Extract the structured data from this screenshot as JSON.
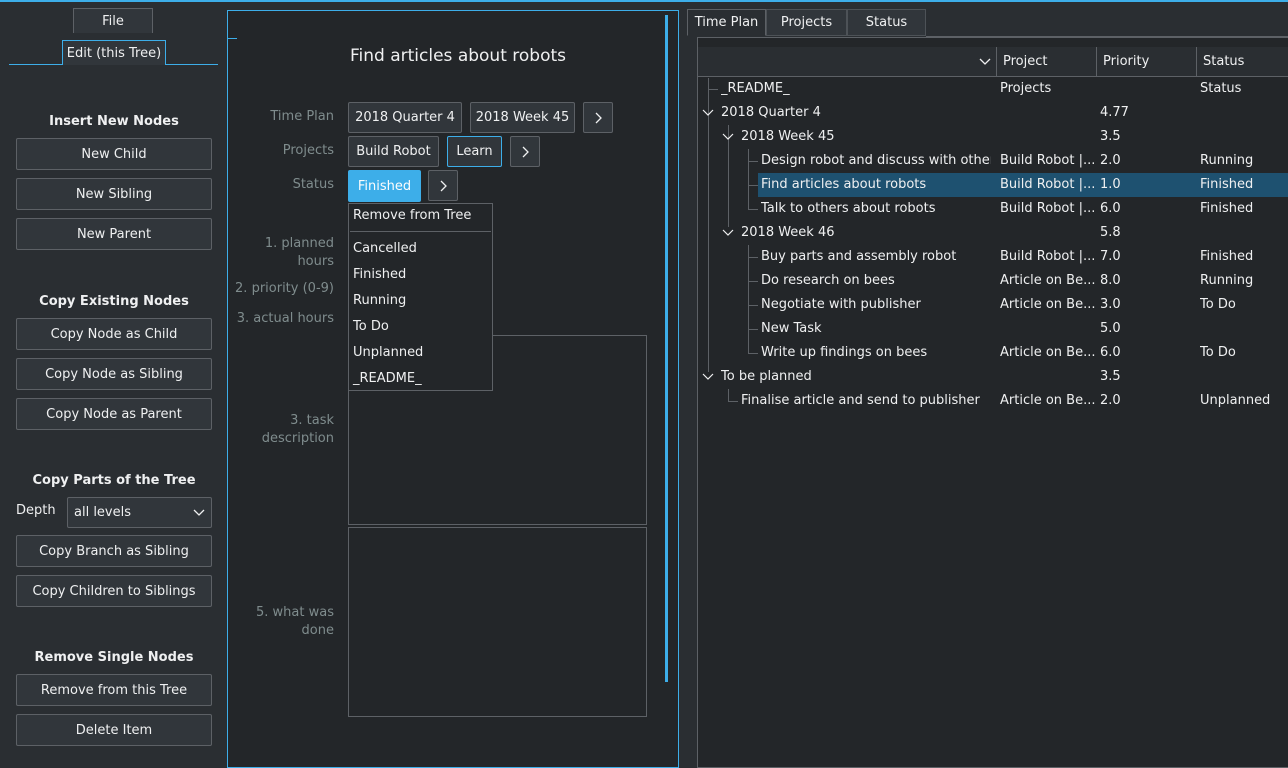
{
  "menu": {
    "file_tab": "File",
    "edit_tab": "Edit (this Tree)"
  },
  "left": {
    "insert": {
      "title": "Insert New Nodes",
      "new_child": "New Child",
      "new_sibling": "New Sibling",
      "new_parent": "New Parent"
    },
    "copy_existing": {
      "title": "Copy Existing Nodes",
      "as_child": "Copy Node as Child",
      "as_sibling": "Copy Node as Sibling",
      "as_parent": "Copy Node as Parent"
    },
    "copy_parts": {
      "title": "Copy Parts of the Tree",
      "depth_label": "Depth",
      "depth_value": "all levels",
      "branch_as_sibling": "Copy Branch as Sibling",
      "children_to_siblings": "Copy Children to Siblings"
    },
    "remove": {
      "title": "Remove Single Nodes",
      "remove_from_tree": "Remove from this Tree",
      "delete_item": "Delete Item"
    }
  },
  "editor": {
    "title": "Find articles about robots",
    "time_plan_label": "Time Plan",
    "time_plan_chips": [
      "2018 Quarter 4",
      "2018 Week 45"
    ],
    "projects_label": "Projects",
    "projects_chips": [
      "Build Robot",
      "Learn"
    ],
    "status_label": "Status",
    "status_chip": "Finished",
    "planned_hours_label": "1. planned hours",
    "priority_label": "2. priority (0-9)",
    "actual_hours_label": "3. actual hours",
    "task_description_label": "3. task description",
    "what_was_done_label": "5. what was done",
    "popup": {
      "remove": "Remove from Tree",
      "items": [
        "Cancelled",
        "Finished",
        "Running",
        "To Do",
        "Unplanned",
        "_README_"
      ]
    }
  },
  "right": {
    "tabs": [
      "Time Plan",
      "Projects",
      "Status"
    ],
    "columns": [
      "Project",
      "Priority",
      "Status"
    ],
    "rows": [
      {
        "name": "_README_",
        "project": "Projects",
        "priority": "",
        "status": "Status"
      },
      {
        "name": "2018 Quarter 4",
        "project": "",
        "priority": "4.77",
        "status": ""
      },
      {
        "name": "2018 Week 45",
        "project": "",
        "priority": "3.5",
        "status": ""
      },
      {
        "name": "Design robot and discuss with others",
        "project": "Build Robot |...",
        "priority": "2.0",
        "status": "Running"
      },
      {
        "name": "Find articles about robots",
        "project": "Build Robot |...",
        "priority": "1.0",
        "status": "Finished"
      },
      {
        "name": "Talk to others about robots",
        "project": "Build Robot |...",
        "priority": "6.0",
        "status": "Finished"
      },
      {
        "name": "2018 Week 46",
        "project": "",
        "priority": "5.8",
        "status": ""
      },
      {
        "name": "Buy parts and assembly robot",
        "project": "Build Robot |...",
        "priority": "7.0",
        "status": "Finished"
      },
      {
        "name": "Do research on bees",
        "project": "Article on Be...",
        "priority": "8.0",
        "status": "Running"
      },
      {
        "name": "Negotiate with publisher",
        "project": "Article on Be...",
        "priority": "3.0",
        "status": "To Do"
      },
      {
        "name": "New Task",
        "project": "",
        "priority": "5.0",
        "status": ""
      },
      {
        "name": "Write up findings on bees",
        "project": "Article on Be...",
        "priority": "6.0",
        "status": "To Do"
      },
      {
        "name": "To be planned",
        "project": "",
        "priority": "3.5",
        "status": ""
      },
      {
        "name": "Finalise article and send to publisher",
        "project": "Article on Be...",
        "priority": "2.0",
        "status": "Unplanned"
      }
    ]
  },
  "icons": {
    "chevron_right": "chevron-right-icon",
    "chevron_down": "chevron-down-icon"
  },
  "colors": {
    "accent": "#3daee9",
    "selection": "#1e5170"
  }
}
